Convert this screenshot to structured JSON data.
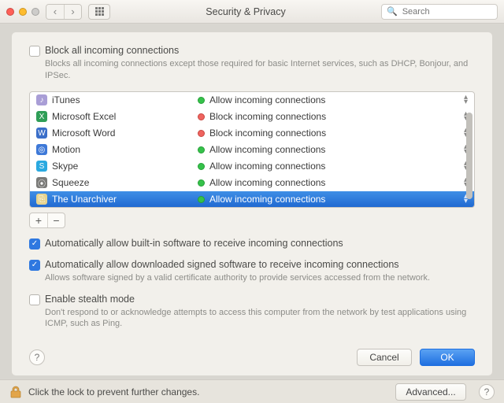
{
  "window": {
    "title": "Security & Privacy",
    "search_placeholder": "Search"
  },
  "block_all": {
    "checked": false,
    "label": "Block all incoming connections",
    "desc": "Blocks all incoming connections except those required for basic Internet services,  such as DHCP, Bonjour, and IPSec."
  },
  "apps": [
    {
      "name": "iTunes",
      "status": "g",
      "action": "Allow incoming connections",
      "icon_bg": "#a99ed6",
      "icon_txt": "♪",
      "selected": false
    },
    {
      "name": "Microsoft Excel",
      "status": "r",
      "action": "Block incoming connections",
      "icon_bg": "#2f9e57",
      "icon_txt": "X",
      "selected": false
    },
    {
      "name": "Microsoft Word",
      "status": "r",
      "action": "Block incoming connections",
      "icon_bg": "#3b6fc9",
      "icon_txt": "W",
      "selected": false
    },
    {
      "name": "Motion",
      "status": "g",
      "action": "Allow incoming connections",
      "icon_bg": "#3e79d8",
      "icon_txt": "◎",
      "selected": false
    },
    {
      "name": "Skype",
      "status": "g",
      "action": "Allow incoming connections",
      "icon_bg": "#2aa9e0",
      "icon_txt": "S",
      "selected": false
    },
    {
      "name": "Squeeze",
      "status": "g",
      "action": "Allow incoming connections",
      "icon_bg": "#7a7a78",
      "icon_txt": "⦿",
      "selected": false
    },
    {
      "name": "The Unarchiver",
      "status": "g",
      "action": "Allow incoming connections",
      "icon_bg": "#e6d38f",
      "icon_txt": "⎘",
      "selected": true
    }
  ],
  "addremove": {
    "plus": "+",
    "minus": "−"
  },
  "auto_builtin": {
    "checked": true,
    "label": "Automatically allow built-in software to receive incoming connections"
  },
  "auto_signed": {
    "checked": true,
    "label": "Automatically allow downloaded signed software to receive incoming connections",
    "desc": "Allows software signed by a valid certificate authority to provide services accessed from the network."
  },
  "stealth": {
    "checked": false,
    "label": "Enable stealth mode",
    "desc": "Don't respond to or acknowledge attempts to access this computer from the network by test applications using ICMP, such as Ping."
  },
  "buttons": {
    "cancel": "Cancel",
    "ok": "OK",
    "advanced": "Advanced...",
    "help": "?"
  },
  "lock": {
    "text": "Click the lock to prevent further changes."
  }
}
